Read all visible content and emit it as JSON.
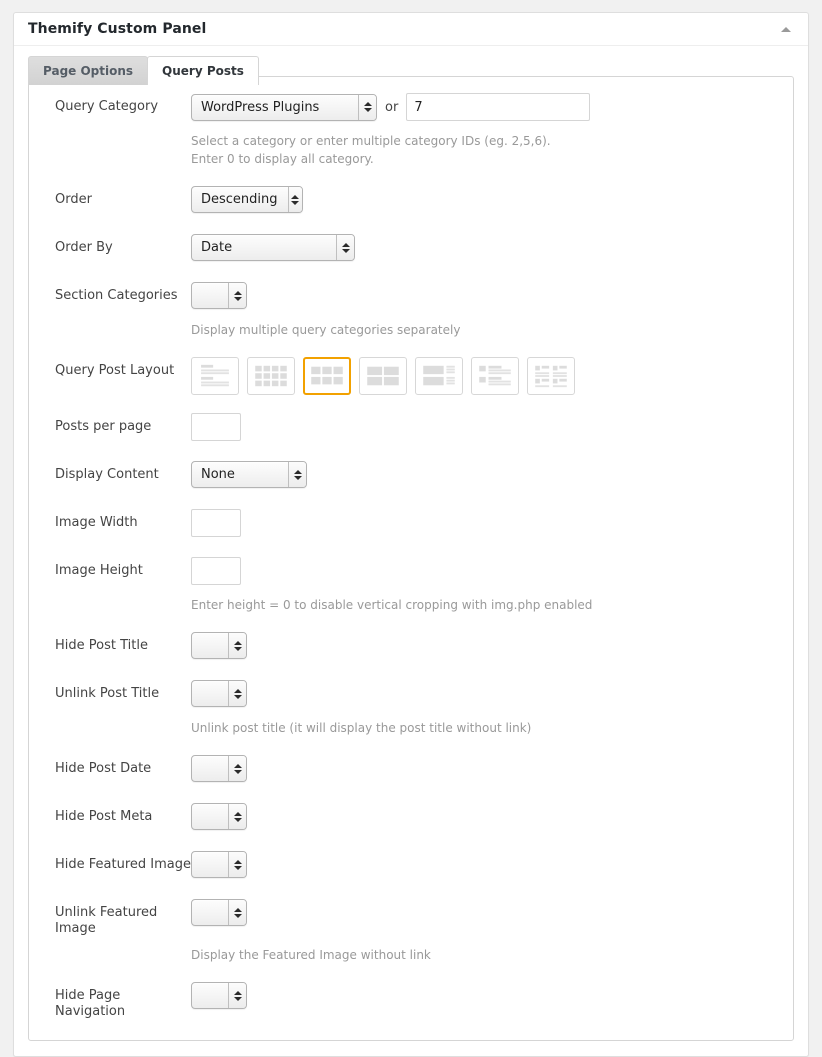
{
  "panel": {
    "title": "Themify Custom Panel",
    "collapse_icon": "triangle-up-icon"
  },
  "tabs": [
    {
      "label": "Page Options",
      "active": false
    },
    {
      "label": "Query Posts",
      "active": true
    }
  ],
  "colors": {
    "selected_border": "#f2a100",
    "panel_bg": "#ffffff",
    "page_bg": "#f1f1f1",
    "label_text": "#444444",
    "desc_text": "#999999"
  },
  "fields": {
    "query_category": {
      "label": "Query Category",
      "select_value": "WordPress Plugins",
      "or_label": "or",
      "ids_value": "7",
      "description": "Select a category or enter multiple category IDs (eg. 2,5,6). Enter 0 to display all category."
    },
    "order": {
      "label": "Order",
      "value": "Descending"
    },
    "order_by": {
      "label": "Order By",
      "value": "Date"
    },
    "section_categories": {
      "label": "Section Categories",
      "value": "",
      "description": "Display multiple query categories separately"
    },
    "query_post_layout": {
      "label": "Query Post Layout",
      "selected_index": 2,
      "options": [
        {
          "name": "list-post-layout"
        },
        {
          "name": "grid4-layout"
        },
        {
          "name": "grid3-layout"
        },
        {
          "name": "grid2-layout"
        },
        {
          "name": "list-large-image-layout"
        },
        {
          "name": "list-thumb-layout"
        },
        {
          "name": "grid2-thumb-layout"
        }
      ]
    },
    "posts_per_page": {
      "label": "Posts per page",
      "value": ""
    },
    "display_content": {
      "label": "Display Content",
      "value": "None"
    },
    "image_width": {
      "label": "Image Width",
      "value": ""
    },
    "image_height": {
      "label": "Image Height",
      "value": "",
      "description": "Enter height = 0 to disable vertical cropping with img.php enabled"
    },
    "hide_post_title": {
      "label": "Hide Post Title",
      "value": ""
    },
    "unlink_post_title": {
      "label": "Unlink Post Title",
      "value": "",
      "description": "Unlink post title (it will display the post title without link)"
    },
    "hide_post_date": {
      "label": "Hide Post Date",
      "value": ""
    },
    "hide_post_meta": {
      "label": "Hide Post Meta",
      "value": ""
    },
    "hide_featured_image": {
      "label": "Hide Featured Image",
      "value": ""
    },
    "unlink_featured_image": {
      "label": "Unlink Featured Image",
      "value": "",
      "description": "Display the Featured Image without link"
    },
    "hide_page_navigation": {
      "label": "Hide Page Navigation",
      "value": ""
    }
  }
}
